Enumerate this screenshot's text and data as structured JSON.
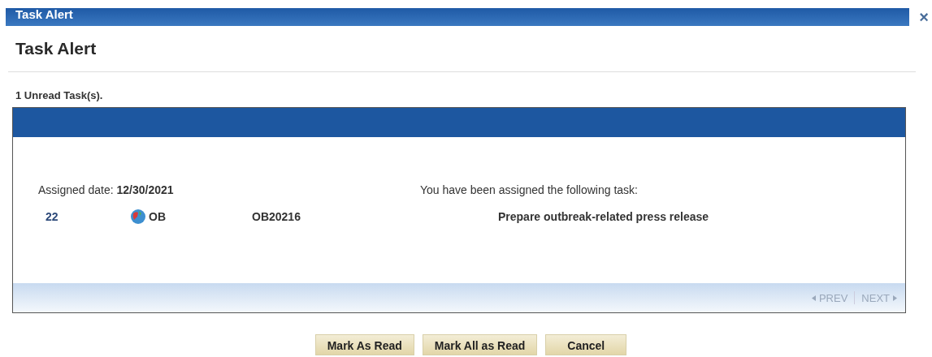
{
  "window": {
    "title": "Task Alert",
    "close": "×"
  },
  "heading": "Task Alert",
  "unread": "1 Unread Task(s).",
  "task": {
    "assigned_label": "Assigned date:",
    "assigned_date": "12/30/2021",
    "message": "You have been assigned the following task:",
    "number": "22",
    "module": "OB",
    "code": "OB20216",
    "description": "Prepare outbreak-related press release"
  },
  "pager": {
    "prev": "PREV",
    "next": "NEXT",
    "disabled": true
  },
  "buttons": [
    "Mark As Read",
    "Mark All as Read",
    "Cancel"
  ]
}
